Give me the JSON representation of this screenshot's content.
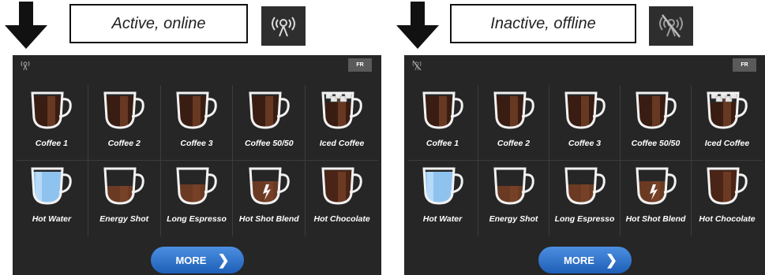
{
  "panels": [
    {
      "caption": "Active, online",
      "status": "online",
      "lang": "FR",
      "more_label": "MORE",
      "drinks": [
        {
          "label": "Coffee 1",
          "fill": "coffee1"
        },
        {
          "label": "Coffee 2",
          "fill": "coffee2"
        },
        {
          "label": "Coffee 3",
          "fill": "coffee3"
        },
        {
          "label": "Coffee 50/50",
          "fill": "coffee5050"
        },
        {
          "label": "Iced Coffee",
          "fill": "iced"
        },
        {
          "label": "Hot Water",
          "fill": "water"
        },
        {
          "label": "Energy Shot",
          "fill": "energy"
        },
        {
          "label": "Long Espresso",
          "fill": "espresso"
        },
        {
          "label": "Hot Shot Blend",
          "fill": "blend"
        },
        {
          "label": "Hot Chocolate",
          "fill": "chocolate"
        }
      ]
    },
    {
      "caption": "Inactive, offline",
      "status": "offline",
      "lang": "FR",
      "more_label": "MORE",
      "drinks": [
        {
          "label": "Coffee 1",
          "fill": "coffee1"
        },
        {
          "label": "Coffee 2",
          "fill": "coffee2"
        },
        {
          "label": "Coffee 3",
          "fill": "coffee3"
        },
        {
          "label": "Coffee 50/50",
          "fill": "coffee5050"
        },
        {
          "label": "Iced Coffee",
          "fill": "iced"
        },
        {
          "label": "Hot Water",
          "fill": "water"
        },
        {
          "label": "Energy Shot",
          "fill": "energy"
        },
        {
          "label": "Long Espresso",
          "fill": "espresso"
        },
        {
          "label": "Hot Shot Blend",
          "fill": "blend"
        },
        {
          "label": "Hot Chocolate",
          "fill": "chocolate"
        }
      ]
    }
  ],
  "colors": {
    "screen_bg": "#262626",
    "accent_button": "#2f74cf",
    "coffee_dark": "#3a1d12",
    "coffee_mid": "#6b3a22",
    "water": "#8fc3ef"
  },
  "icons": {
    "pointer": "down-arrow-icon",
    "online": "antenna-signal-icon",
    "offline": "antenna-off-icon",
    "more": "chevron-right-icon"
  }
}
